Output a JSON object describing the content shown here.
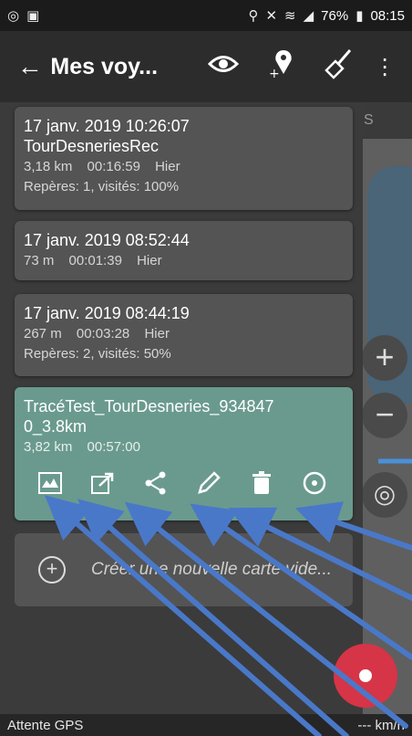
{
  "status_bar": {
    "battery": "76%",
    "time": "08:15"
  },
  "app_bar": {
    "title": "Mes voy..."
  },
  "map": {
    "tab_partial": "S"
  },
  "tracks": [
    {
      "title": "17 janv. 2019 10:26:07",
      "name": "TourDesneriesRec",
      "distance": "3,18 km",
      "duration": "00:16:59",
      "when": "Hier",
      "marks": "Repères: 1, visités: 100%"
    },
    {
      "title": "17 janv. 2019 08:52:44",
      "distance": "73 m",
      "duration": "00:01:39",
      "when": "Hier"
    },
    {
      "title": "17 janv. 2019 08:44:19",
      "distance": "267 m",
      "duration": "00:03:28",
      "when": "Hier",
      "marks": "Repères: 2, visités: 50%"
    },
    {
      "title": "TracéTest_TourDesneries_934847",
      "title2": "0_3.8km",
      "distance": "3,82 km",
      "duration": "00:57:00"
    }
  ],
  "new_map": {
    "label": "Créer une nouvelle carte vide..."
  },
  "bottom_bar": {
    "gps_status": "Attente GPS",
    "speed": "--- km/h"
  },
  "colors": {
    "selected_card": "#6a9a8e",
    "fab": "#d63447",
    "arrows": "#4a78c8"
  }
}
